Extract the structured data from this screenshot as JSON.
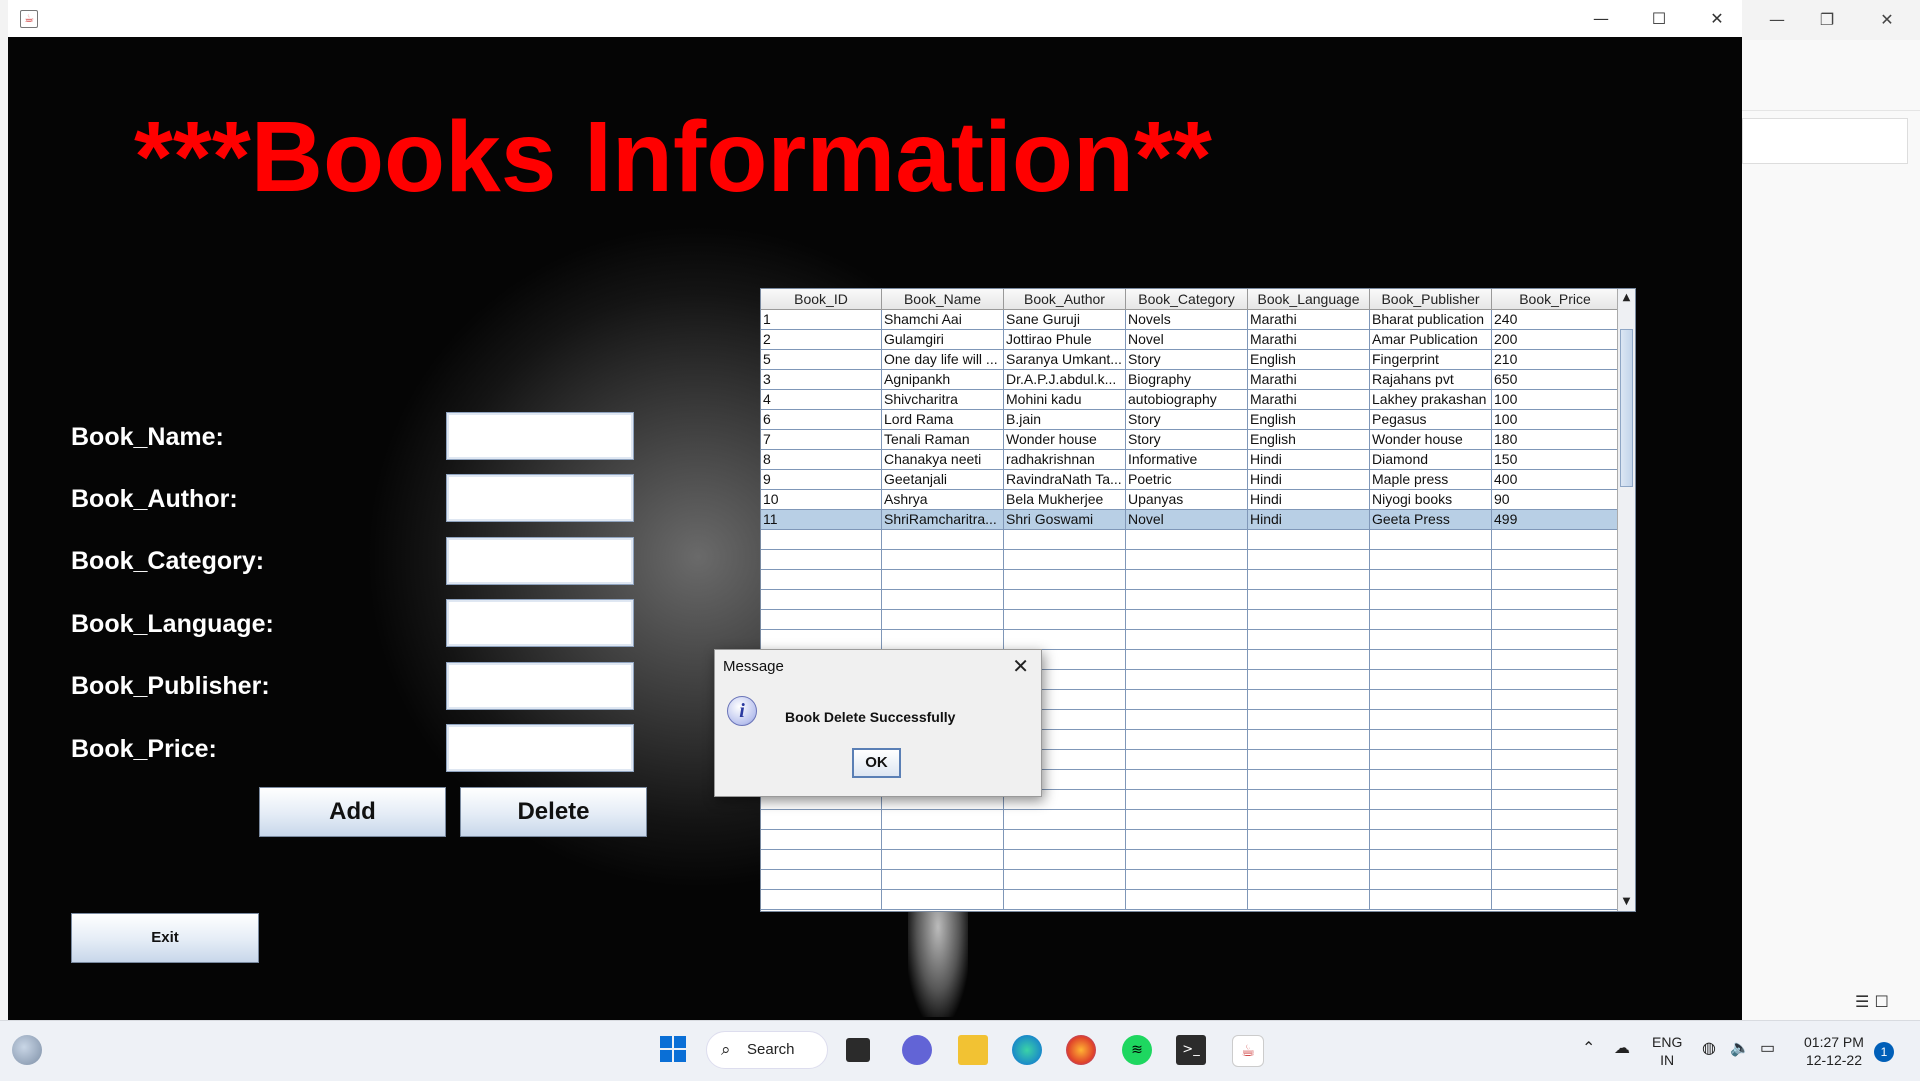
{
  "window": {
    "heading": "***Books Information**",
    "controls": {
      "minimize": "—",
      "maximize": "☐",
      "close": "✕"
    }
  },
  "form": {
    "labels": [
      "Book_Name:",
      "Book_Author:",
      "Book_Category:",
      "Book_Language:",
      "Book_Publisher:",
      "Book_Price:"
    ],
    "values": [
      "",
      "",
      "",
      "",
      "",
      ""
    ],
    "add_label": "Add",
    "delete_label": "Delete",
    "exit_label": "Exit"
  },
  "table": {
    "columns": [
      "Book_ID",
      "Book_Name",
      "Book_Author",
      "Book_Category",
      "Book_Language",
      "Book_Publisher",
      "Book_Price"
    ],
    "rows": [
      [
        "1",
        "Shamchi Aai",
        "Sane Guruji",
        "Novels",
        "Marathi",
        "Bharat publication",
        "240"
      ],
      [
        "2",
        "Gulamgiri",
        "Jottirao Phule",
        "Novel",
        "Marathi",
        "Amar Publication",
        "200"
      ],
      [
        "5",
        "One day life will ...",
        "Saranya Umkant...",
        "Story",
        "English",
        "Fingerprint",
        "210"
      ],
      [
        "3",
        "Agnipankh",
        "Dr.A.P.J.abdul.k...",
        "Biography",
        "Marathi",
        "Rajahans pvt",
        "650"
      ],
      [
        "4",
        "Shivcharitra",
        "Mohini kadu",
        "autobiography",
        "Marathi",
        "Lakhey prakashan",
        "100"
      ],
      [
        "6",
        "Lord Rama",
        "B.jain",
        "Story",
        "English",
        "Pegasus",
        "100"
      ],
      [
        "7",
        "Tenali Raman",
        "Wonder house",
        "Story",
        "English",
        "Wonder house",
        "180"
      ],
      [
        "8",
        "Chanakya neeti",
        "radhakrishnan",
        "Informative",
        "Hindi",
        "Diamond",
        "150"
      ],
      [
        "9",
        "Geetanjali",
        "RavindraNath Ta...",
        "Poetric",
        "Hindi",
        "Maple press",
        "400"
      ],
      [
        "10",
        "Ashrya",
        "Bela Mukherjee",
        "Upanyas",
        "Hindi",
        "Niyogi books",
        "90"
      ],
      [
        "11",
        "ShriRamcharitra...",
        "Shri Goswami",
        "Novel",
        "Hindi",
        "Geeta Press",
        "499"
      ]
    ],
    "selected_row": 10,
    "empty_rows": 19
  },
  "dialog": {
    "title": "Message",
    "message": "Book Delete Successfully",
    "ok_label": "OK",
    "close": "✕"
  },
  "taskbar": {
    "search_label": "Search",
    "language_line1": "ENG",
    "language_line2": "IN",
    "time": "01:27 PM",
    "date": "12-12-22",
    "notification_count": "1"
  }
}
